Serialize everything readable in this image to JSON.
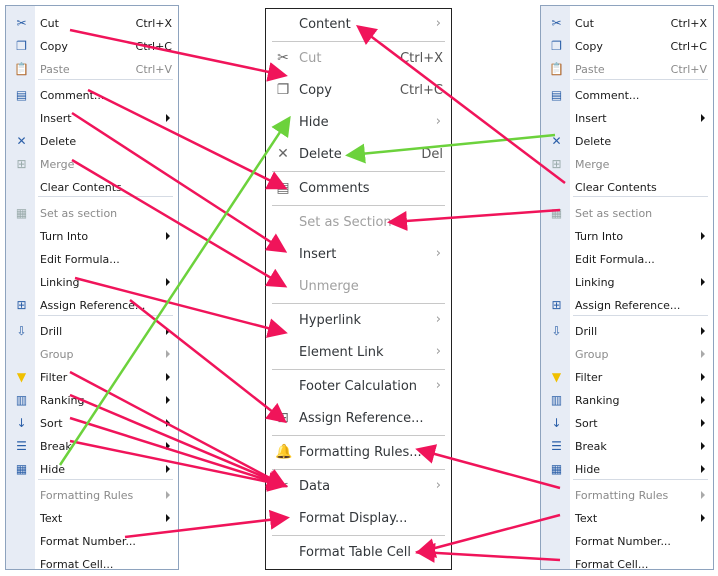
{
  "old_menu": {
    "items": [
      {
        "label": "Cut",
        "shortcut": "Ctrl+X",
        "icon": "scissors-icon"
      },
      {
        "label": "Copy",
        "shortcut": "Ctrl+C",
        "icon": "copy-icon"
      },
      {
        "label": "Paste",
        "shortcut": "Ctrl+V",
        "icon": "paste-icon",
        "disabled": true
      },
      {
        "label": "Comment...",
        "icon": "comment-icon"
      },
      {
        "label": "Insert",
        "submenu": true
      },
      {
        "label": "Delete",
        "icon": "delete-x-icon"
      },
      {
        "label": "Merge",
        "icon": "merge-icon",
        "disabled": true
      },
      {
        "label": "Clear Contents"
      },
      {
        "label": "Set as section",
        "icon": "section-icon",
        "disabled": true
      },
      {
        "label": "Turn Into",
        "submenu": true
      },
      {
        "label": "Edit Formula..."
      },
      {
        "label": "Linking",
        "submenu": true
      },
      {
        "label": "Assign Reference...",
        "icon": "assign-reference-icon"
      },
      {
        "label": "Drill",
        "icon": "drill-icon",
        "submenu": true
      },
      {
        "label": "Group",
        "submenu": true,
        "disabled": true
      },
      {
        "label": "Filter",
        "icon": "filter-icon",
        "submenu": true
      },
      {
        "label": "Ranking",
        "icon": "ranking-icon",
        "submenu": true
      },
      {
        "label": "Sort",
        "icon": "sort-az-icon",
        "submenu": true
      },
      {
        "label": "Break",
        "icon": "break-icon",
        "submenu": true
      },
      {
        "label": "Hide",
        "icon": "hide-columns-icon",
        "submenu": true
      },
      {
        "label": "Formatting Rules",
        "submenu": true,
        "disabled": true
      },
      {
        "label": "Text",
        "submenu": true
      },
      {
        "label": "Format Number..."
      },
      {
        "label": "Format Cell..."
      }
    ]
  },
  "new_menu": {
    "items": [
      {
        "label": "Content",
        "submenu": true
      },
      {
        "label": "Cut",
        "shortcut": "Ctrl+X",
        "icon": "scissors-icon",
        "disabled": true
      },
      {
        "label": "Copy",
        "shortcut": "Ctrl+C",
        "icon": "copy-icon"
      },
      {
        "label": "Hide",
        "submenu": true
      },
      {
        "label": "Delete",
        "shortcut": "Del",
        "icon": "delete-x-icon"
      },
      {
        "label": "Comments",
        "icon": "comment-icon"
      },
      {
        "label": "Set as Section",
        "disabled": true
      },
      {
        "label": "Insert",
        "submenu": true
      },
      {
        "label": "Unmerge",
        "disabled": true
      },
      {
        "label": "Hyperlink",
        "submenu": true
      },
      {
        "label": "Element Link",
        "submenu": true
      },
      {
        "label": "Footer Calculation",
        "submenu": true
      },
      {
        "label": "Assign Reference...",
        "icon": "assign-reference-icon"
      },
      {
        "label": "Formatting Rules...",
        "icon": "bell-icon"
      },
      {
        "label": "Data",
        "icon": "data-tools-icon",
        "submenu": true
      },
      {
        "label": "Format Display..."
      },
      {
        "label": "Format Table Cell"
      }
    ]
  },
  "colors": {
    "mapping_arrow": "#f0145a",
    "delete_hide_arrow": "#6cd23c"
  }
}
